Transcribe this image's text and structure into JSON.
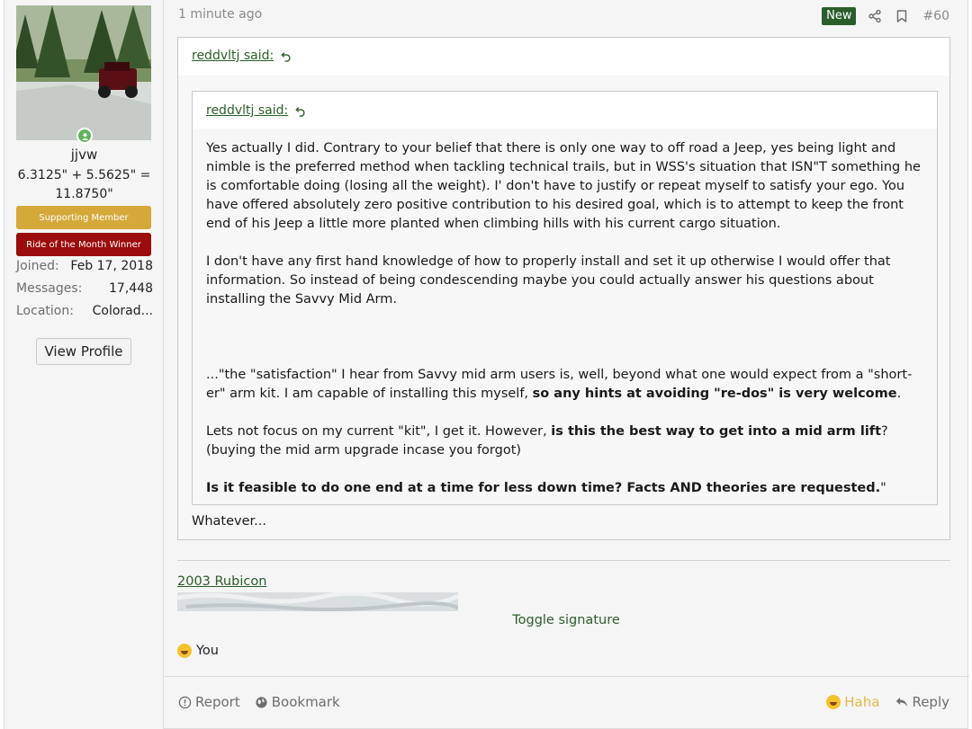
{
  "user": {
    "name": "jjvw",
    "title": "6.3125\" + 5.5625\" = 11.8750\"",
    "banners": [
      "Supporting Member",
      "Ride of the Month Winner"
    ],
    "stats": [
      {
        "key": "Joined:",
        "value": "Feb 17, 2018"
      },
      {
        "key": "Messages:",
        "value": "17,448"
      },
      {
        "key": "Location:",
        "value": "Colorad..."
      }
    ],
    "view_profile_label": "View Profile"
  },
  "post": {
    "time": "1 minute ago",
    "new_badge": "New",
    "number": "#60",
    "outer_quote_attr": "reddvltj said:",
    "inner_quote_attr": "reddvltj said:",
    "inner_quote": {
      "p1": "Yes actually I did. Contrary to your belief that there is only one way to off road a Jeep, yes being light and nimble is the preferred method when tackling technical trails, but in WSS's situation that ISN\"T something he is comfortable doing (losing all the weight). I' don't have to justify or repeat myself to satisfy your ego. You have offered absolutely zero positive contribution to his desired goal, which is to attempt to keep the front end of his Jeep a little more planted when climbing hills with his current cargo situation.",
      "p2": "I don't have any first hand knowledge of how to properly install and set it up otherwise I would offer that information. So instead of being condescending maybe you could actually answer his questions about installing the Savvy Mid Arm.",
      "p3_plain": "...\"the \"satisfaction\" I hear from Savvy mid arm users is, well, beyond what one would expect from a \"short-er\" arm kit. I am capable of installing this myself, ",
      "p3_bold": "so any hints at avoiding \"re-dos\" is very welcome",
      "p3_end": ".",
      "p4_plain": "Lets not focus on my current \"kit\", I get it. However, ",
      "p4_bold": "is this the best way to get into a mid arm lift",
      "p4_end": "?",
      "p4_line2": "(buying the mid arm upgrade incase you forgot)",
      "p5_bold": "Is it feasible to do one end at a time for less down time? Facts AND theories are requested.",
      "p5_end": "\""
    },
    "reply_text": "Whatever...",
    "signature_link": "2003 Rubicon",
    "signature_toggle": "Toggle signature",
    "reaction_text": "You"
  },
  "footer": {
    "report": "Report",
    "bookmark": "Bookmark",
    "haha": "Haha",
    "reply": "Reply"
  },
  "colors": {
    "accent_green": "#2b5e2b",
    "supporting_banner": "#d4a93a",
    "rotm_banner": "#9b0c0c",
    "haha": "#e6b84a"
  }
}
